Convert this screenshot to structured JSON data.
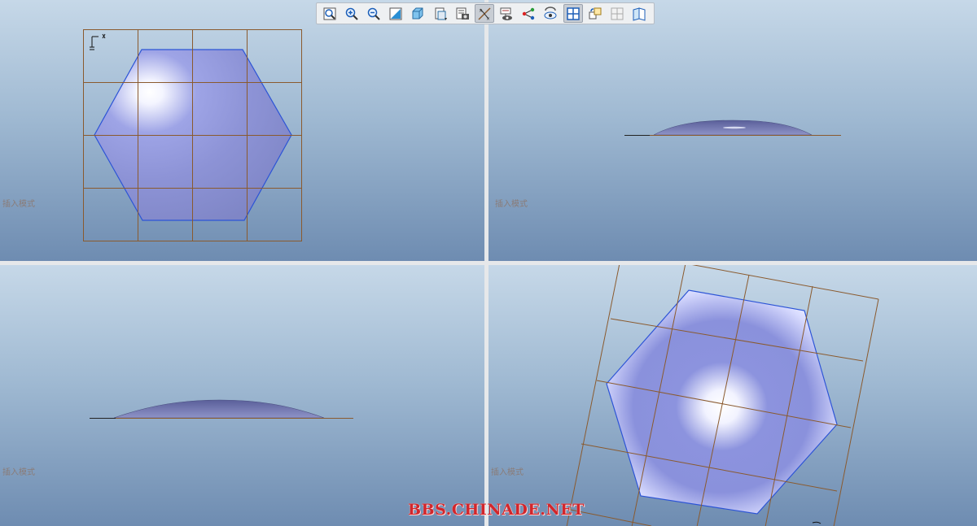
{
  "toolbar": {
    "buttons": [
      {
        "name": "zoom-fit-icon",
        "label": "Refit"
      },
      {
        "name": "zoom-in-icon",
        "label": "Zoom In"
      },
      {
        "name": "zoom-out-icon",
        "label": "Zoom Out"
      },
      {
        "name": "repaint-icon",
        "label": "Repaint"
      },
      {
        "name": "display-style-icon",
        "label": "Display Style"
      },
      {
        "name": "saved-views-icon",
        "label": "Saved Views"
      },
      {
        "name": "view-manager-icon",
        "label": "View Manager"
      },
      {
        "name": "datum-display-icon",
        "label": "Datum Display"
      },
      {
        "name": "annotation-display-icon",
        "label": "Annotation Display"
      },
      {
        "name": "spin-center-icon",
        "label": "Spin Center"
      },
      {
        "name": "hide-show-icon",
        "label": "Hide/Show"
      },
      {
        "name": "four-view-icon",
        "label": "Four Views"
      },
      {
        "name": "orientation-icon",
        "label": "Orientation"
      },
      {
        "name": "section-icon",
        "label": "Section"
      },
      {
        "name": "annotation-plane-icon",
        "label": "Annotation Plane"
      }
    ],
    "active": [
      "datum-display-icon",
      "four-view-icon"
    ]
  },
  "viewports": {
    "top_left": {
      "status": "插入模式"
    },
    "top_right": {
      "status": "插入模式"
    },
    "bottom_left": {
      "status": "插入模式"
    },
    "bottom_right": {
      "status": "插入模式"
    }
  },
  "watermark": "BBS.CHINADE.NET",
  "colors": {
    "grid": "#8a5a2e",
    "edge": "#2c54d6",
    "surface": "#8e95d8",
    "highlight": "#ffffff"
  }
}
